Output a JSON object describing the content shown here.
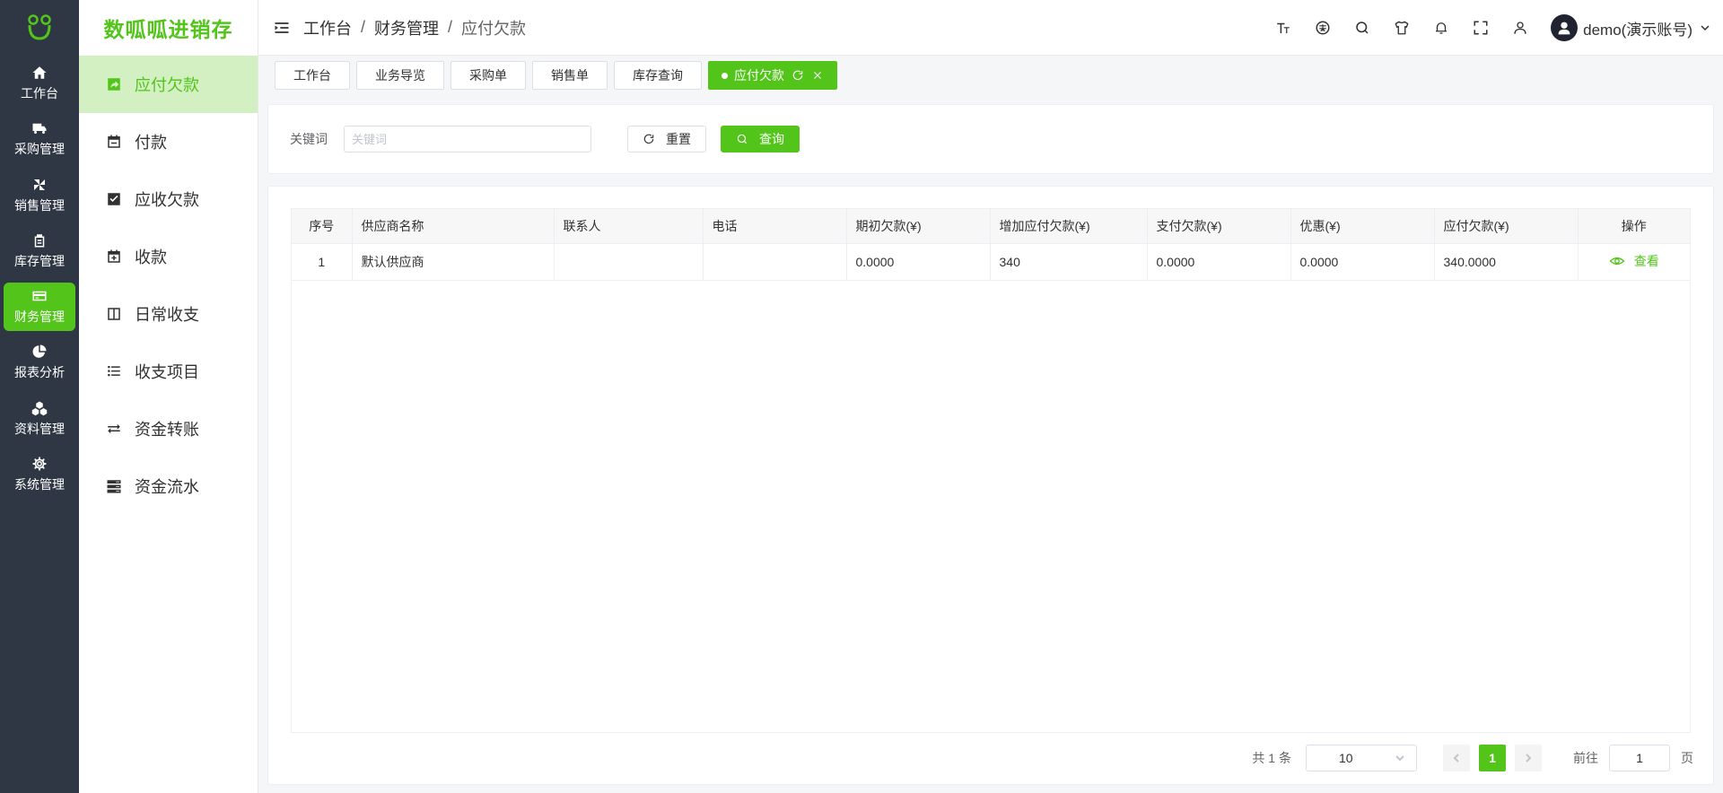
{
  "app": {
    "brand": "数呱呱进销存",
    "accent": "#52c41a",
    "rail_bg": "#2f3744"
  },
  "rail": {
    "items": [
      {
        "label": "工作台",
        "icon": "home-icon"
      },
      {
        "label": "采购管理",
        "icon": "truck-icon"
      },
      {
        "label": "销售管理",
        "icon": "pinwheel-icon"
      },
      {
        "label": "库存管理",
        "icon": "clipboard-icon"
      },
      {
        "label": "财务管理",
        "icon": "card-icon",
        "active": true
      },
      {
        "label": "报表分析",
        "icon": "pie-chart-icon"
      },
      {
        "label": "资料管理",
        "icon": "cubes-icon"
      },
      {
        "label": "系统管理",
        "icon": "gear-icon"
      }
    ]
  },
  "submenu": {
    "items": [
      {
        "label": "应付欠款",
        "icon": "share-square-icon",
        "active": true
      },
      {
        "label": "付款",
        "icon": "calendar-minus-icon"
      },
      {
        "label": "应收欠款",
        "icon": "check-square-icon"
      },
      {
        "label": "收款",
        "icon": "calendar-plus-icon"
      },
      {
        "label": "日常收支",
        "icon": "columns-icon"
      },
      {
        "label": "收支项目",
        "icon": "list-icon"
      },
      {
        "label": "资金转账",
        "icon": "exchange-icon"
      },
      {
        "label": "资金流水",
        "icon": "server-icon"
      }
    ]
  },
  "header": {
    "breadcrumb": [
      "工作台",
      "财务管理",
      "应付欠款"
    ],
    "username": "demo(演示账号)",
    "tools": [
      "font-size-icon",
      "language-icon",
      "search-icon",
      "shirt-icon",
      "bell-icon",
      "fullscreen-icon",
      "user-icon"
    ]
  },
  "tabs": [
    {
      "label": "工作台"
    },
    {
      "label": "业务导览"
    },
    {
      "label": "采购单"
    },
    {
      "label": "销售单"
    },
    {
      "label": "库存查询"
    },
    {
      "label": "应付欠款",
      "active": true
    }
  ],
  "search": {
    "label": "关键词",
    "placeholder": "关键词",
    "value": "",
    "reset_label": "重置",
    "query_label": "查询"
  },
  "table": {
    "columns": [
      "序号",
      "供应商名称",
      "联系人",
      "电话",
      "期初欠款(¥)",
      "增加应付欠款(¥)",
      "支付欠款(¥)",
      "优惠(¥)",
      "应付欠款(¥)",
      "操作"
    ],
    "rows": [
      {
        "index": "1",
        "supplier": "默认供应商",
        "contact": "",
        "phone": "",
        "opening": "0.0000",
        "added": "340",
        "paid": "0.0000",
        "discount": "0.0000",
        "payable": "340.0000",
        "action": "查看"
      }
    ]
  },
  "pagination": {
    "total_text": "共 1 条",
    "page_size": "10",
    "current_page": "1",
    "goto_label": "前往",
    "goto_value": "1",
    "page_unit": "页"
  }
}
